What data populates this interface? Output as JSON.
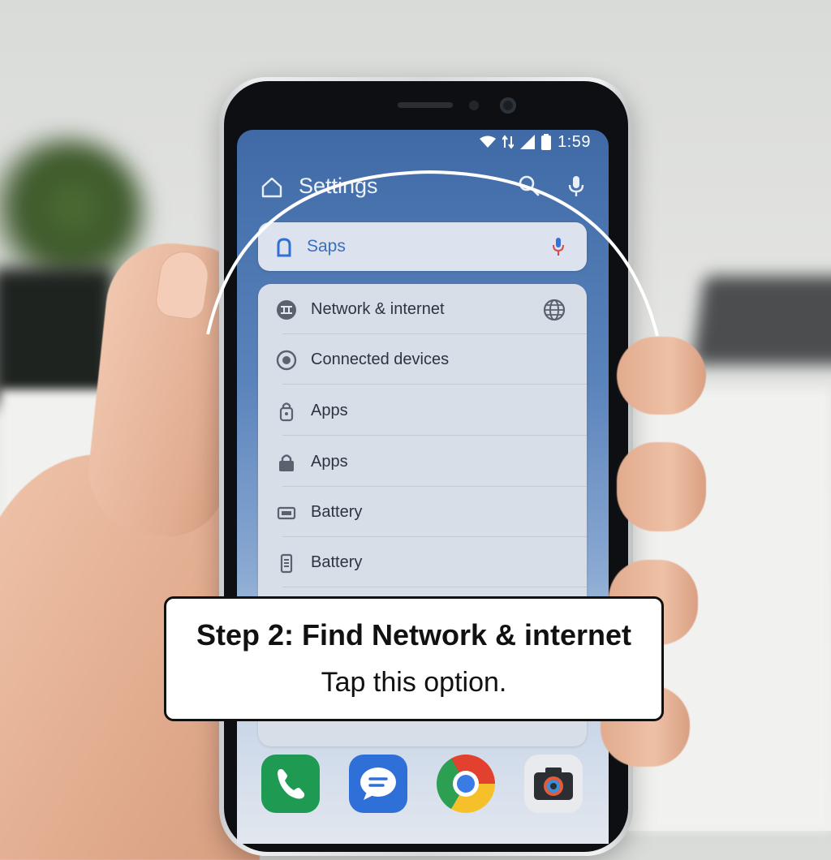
{
  "status_bar": {
    "time": "1:59",
    "icons": [
      "wifi-icon",
      "signal-icon",
      "battery-icon"
    ]
  },
  "header": {
    "title": "Settings",
    "icons": [
      "home-icon",
      "search-icon",
      "mic-icon"
    ]
  },
  "search": {
    "value": "Saps",
    "icons": [
      "assistant-icon",
      "mic-icon"
    ]
  },
  "settings_list": [
    {
      "label": "Network & internet",
      "icon": "network-icon",
      "trailing_icon": "globe-icon"
    },
    {
      "label": "Connected devices",
      "icon": "devices-icon"
    },
    {
      "label": "Apps",
      "icon": "apps-icon"
    },
    {
      "label": "Apps",
      "icon": "lock-icon"
    },
    {
      "label": "Battery",
      "icon": "battery-icon"
    },
    {
      "label": "Battery",
      "icon": "battery-saver-icon"
    }
  ],
  "dock": {
    "apps": [
      "phone-app-icon",
      "messages-app-icon",
      "chrome-app-icon",
      "camera-app-icon"
    ]
  },
  "callout": {
    "heading": "Step 2: Find Network & internet",
    "body": "Tap this option."
  },
  "colors": {
    "screen_top": "#3f6aa6",
    "accent": "#3a6fc0",
    "callout_border": "#111111"
  }
}
